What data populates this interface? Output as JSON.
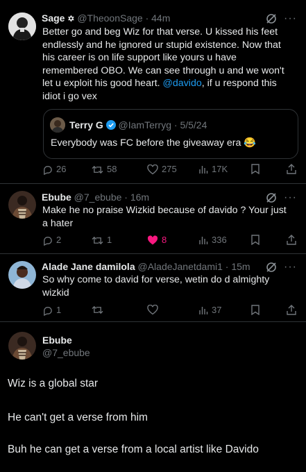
{
  "tweets": [
    {
      "name": "Sage",
      "name_symbol": "✡",
      "handle": "@TheoonSage",
      "time": "· 44m",
      "text_lines": [
        "Better go and beg Wiz for that verse. U kissed his feet",
        "endlessly and he ignored ur stupid existence. Now that",
        "his career is on life support like yours u have",
        "remembered OBO. We can see through u and we won't"
      ],
      "line5_pre": "let u exploit his good heart. ",
      "mention": "@davido",
      "line5_post": ", if u respond this",
      "line6": "idiot i go vex",
      "quote": {
        "name": "Terry G",
        "handle": "@IamTerryg",
        "date": "· 5/5/24",
        "text": "Everybody was FC before the giveaway era 😂"
      },
      "actions": {
        "replies": "26",
        "reposts": "58",
        "likes": "275",
        "views": "17K"
      }
    },
    {
      "name": "Ebube",
      "handle": "@7_ebube",
      "time": "· 16m",
      "text_lines": [
        "Make he no praise Wizkid because of davido ? Your just",
        "a hater"
      ],
      "actions": {
        "replies": "2",
        "reposts": "1",
        "likes": "8",
        "views": "336"
      }
    },
    {
      "name": "Alade Jane damilola",
      "handle": "@AladeJanetdami1",
      "time": "· 15m",
      "text_lines": [
        "So why come to david for verse, wetin do d almighty",
        "wizkid"
      ],
      "actions": {
        "replies": "1",
        "reposts": "",
        "likes": "",
        "views": "37"
      }
    }
  ],
  "focused": {
    "name": "Ebube",
    "handle": "@7_ebube",
    "paragraphs": [
      "Wiz is a global star",
      "He can't get a verse from him",
      "Buh he can get a verse from a local artist like Davido"
    ]
  },
  "colors": {
    "accent": "#1d9bf0",
    "like": "#f91880",
    "muted": "#71767b",
    "text": "#e7e9ea"
  }
}
